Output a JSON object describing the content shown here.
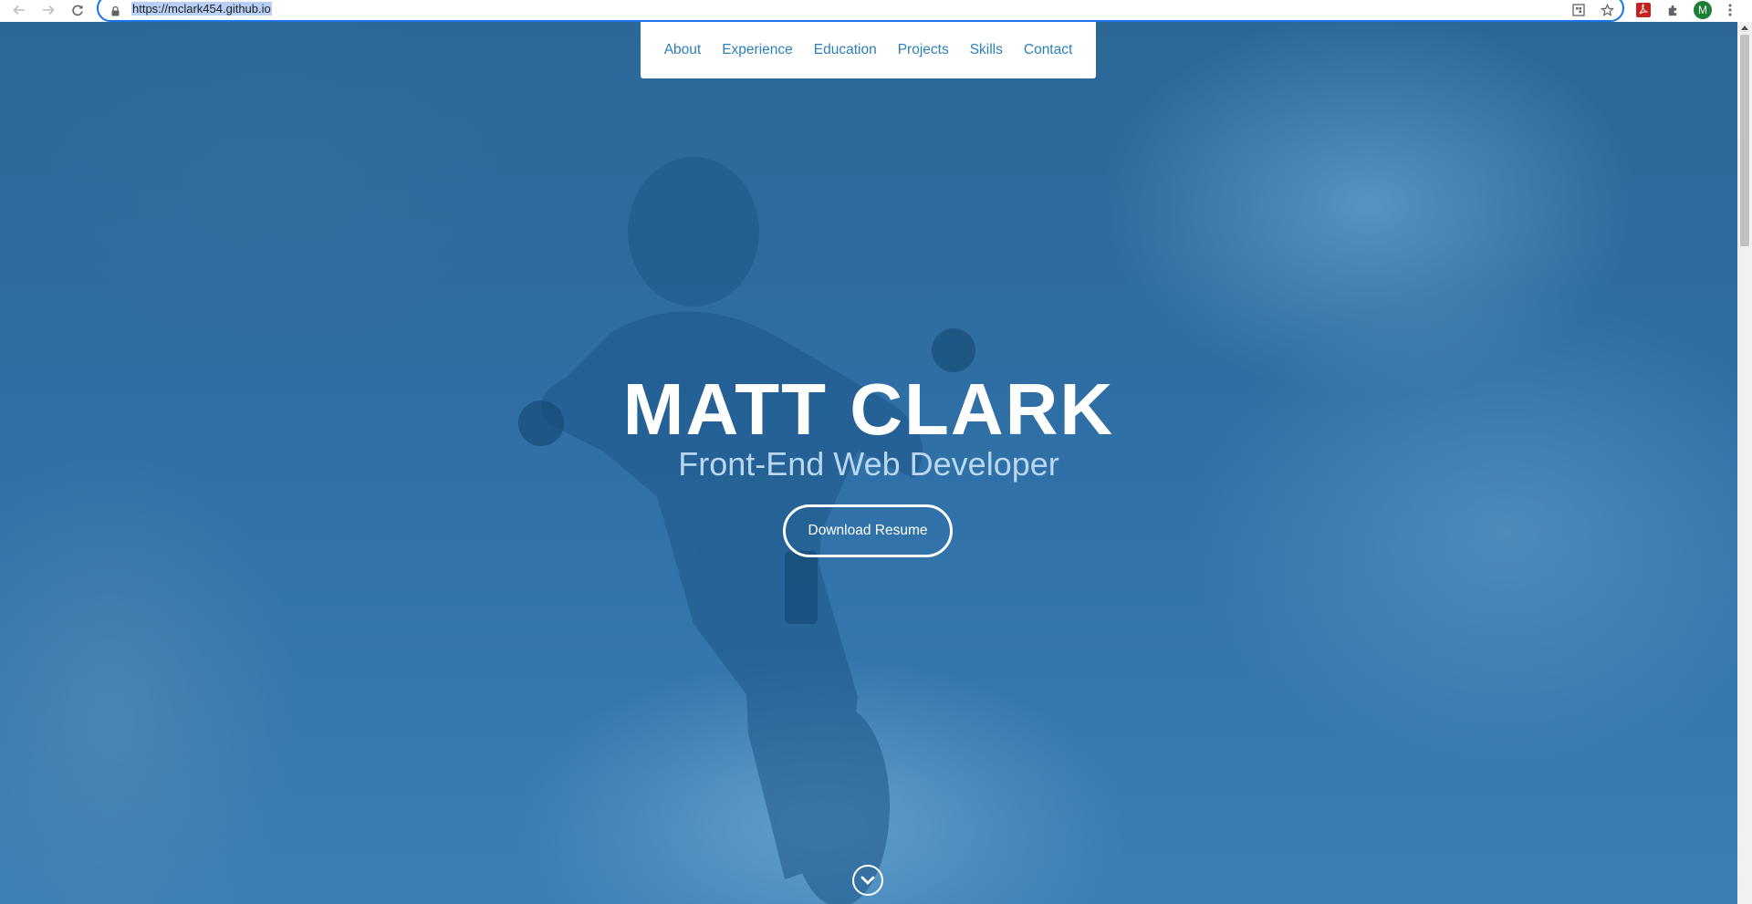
{
  "browser": {
    "url": "https://mclark454.github.io",
    "profile_initial": "M",
    "icons": [
      "back-icon",
      "forward-icon",
      "reload-icon",
      "lock-icon",
      "qr-code-icon",
      "bookmark-star-icon",
      "pdf-extension-icon",
      "extensions-puzzle-icon",
      "profile-avatar",
      "kebab-menu-icon"
    ]
  },
  "nav": {
    "items": [
      {
        "label": "About"
      },
      {
        "label": "Experience"
      },
      {
        "label": "Education"
      },
      {
        "label": "Projects"
      },
      {
        "label": "Skills"
      },
      {
        "label": "Contact"
      }
    ]
  },
  "hero": {
    "title": "MATT CLARK",
    "subtitle": "Front-End Web Developer",
    "cta_label": "Download Resume",
    "scroll_icon": "chevron-down-circle-icon"
  },
  "colors": {
    "overlay": "#2d6fa5",
    "nav_link": "#2c7fb8",
    "subtitle": "#b9d7ef",
    "omnibox_focus": "#1a73e8"
  }
}
